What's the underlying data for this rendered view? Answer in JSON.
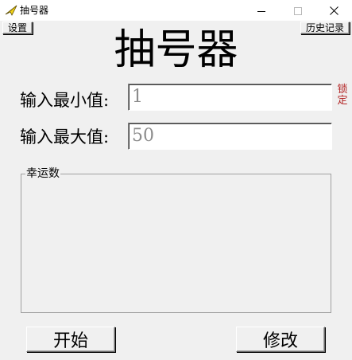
{
  "window": {
    "title": "抽号器",
    "icon": "paper-plane-icon",
    "controls": {
      "minimize": "minimize-icon",
      "maximize": "maximize-icon",
      "close": "close-icon"
    }
  },
  "toolbar": {
    "settings_label": "设置",
    "history_label": "历史记录"
  },
  "heading": "抽号器",
  "form": {
    "min_label": "输入最小值:",
    "min_value": "1",
    "max_label": "输入最大值:",
    "max_value": "50",
    "lock_label": "锁定"
  },
  "lucky": {
    "title": "幸运数",
    "value": ""
  },
  "actions": {
    "start_label": "开始",
    "edit_label": "修改"
  },
  "colors": {
    "lock_text": "#b22222",
    "input_text": "#8c8c8c",
    "window_bg": "#f0f0f0"
  }
}
